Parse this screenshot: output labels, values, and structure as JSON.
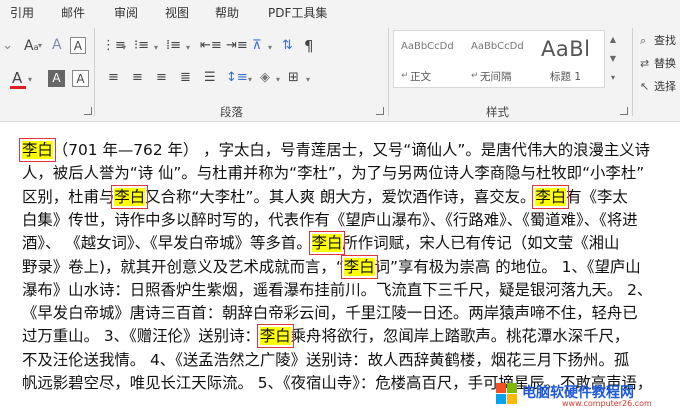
{
  "ribbon": {
    "tabs": [
      "引用",
      "邮件",
      "审阅",
      "视图",
      "帮助",
      "PDF工具集"
    ],
    "groups": {
      "paragraph": "段落",
      "styles": "样式"
    },
    "styles": [
      {
        "sample": "AaBbCcDd",
        "name": "正文"
      },
      {
        "sample": "AaBbCcDd",
        "name": "无间隔"
      },
      {
        "sample": "AaBl",
        "name": "标题 1"
      }
    ],
    "editing": {
      "find": "查找",
      "replace": "替换",
      "select": "选择"
    },
    "font": {
      "color_letter": "A",
      "shade_letter": "A",
      "effect_letter": "A",
      "clear_letter": "A"
    },
    "accent_colors": {
      "font_color": "#e02020",
      "highlight": "#ffff00"
    }
  },
  "document": {
    "lines": [
      [
        {
          "t": "李白",
          "hl": true,
          "box": true
        },
        {
          "t": "（701 年—762 年）  ，字太白，号青莲居士，又号“谪仙人”。是唐代伟大的浪漫主义诗"
        }
      ],
      [
        {
          "t": "人，被后人誉为“诗 仙”。与杜甫并称为“李杜”，为了与另两位诗人李商隐与杜牧即“小李杜”"
        }
      ],
      [
        {
          "t": "区别，杜甫与"
        },
        {
          "t": "李白",
          "hl": true,
          "box": true
        },
        {
          "t": "又合称“大李杜”。其人爽 朗大方，爱饮酒作诗，喜交友。"
        },
        {
          "t": "李白",
          "hl": true,
          "box": true
        },
        {
          "t": "有《李太"
        }
      ],
      [
        {
          "t": "白集》传世，诗作中多以醉时写的，代表作有《望庐山瀑布》、《行路难》、《蜀道难》、《将进"
        }
      ],
      [
        {
          "t": "酒》、 《越女词》、《早发白帝城》等多首。"
        },
        {
          "t": "李白",
          "hl": true,
          "box": true
        },
        {
          "t": "所作词赋，宋人已有传记（如文莹《湘山"
        }
      ],
      [
        {
          "t": "野录》卷上)，就其开创意义及艺术成就而言，“"
        },
        {
          "t": "李白",
          "hl": true,
          "box": true
        },
        {
          "t": "词”享有极为崇高 的地位。 1、《望庐山"
        }
      ],
      [
        {
          "t": "瀑布》山水诗：日照香炉生紫烟，遥看瀑布挂前川。飞流直下三千尺，疑是银河落九天。 2、"
        }
      ],
      [
        {
          "t": "《早发白帝城》唐诗三百首：朝辞白帝彩云间，千里江陵一日还。两岸猿声啼不住，轻舟已"
        }
      ],
      [
        {
          "t": "过万重山。 3、《赠汪伦》送别诗："
        },
        {
          "t": "李白",
          "hl": true,
          "box": true
        },
        {
          "t": "乘舟将欲行，忽闻岸上踏歌声。桃花潭水深千尺，"
        }
      ],
      [
        {
          "t": "不及汪伦送我情。 4、《送孟浩然之广陵》送别诗：故人西辞黄鹤楼，烟花三月下扬州。孤"
        }
      ],
      [
        {
          "t": "帆远影碧空尽，唯见长江天际流。 5、《夜宿山寺》：危楼高百尺，手可摘星辰。不敢高声语，"
        }
      ]
    ]
  },
  "watermark": {
    "title": "电脑软硬件教程网",
    "url": "www.computer26.com"
  }
}
